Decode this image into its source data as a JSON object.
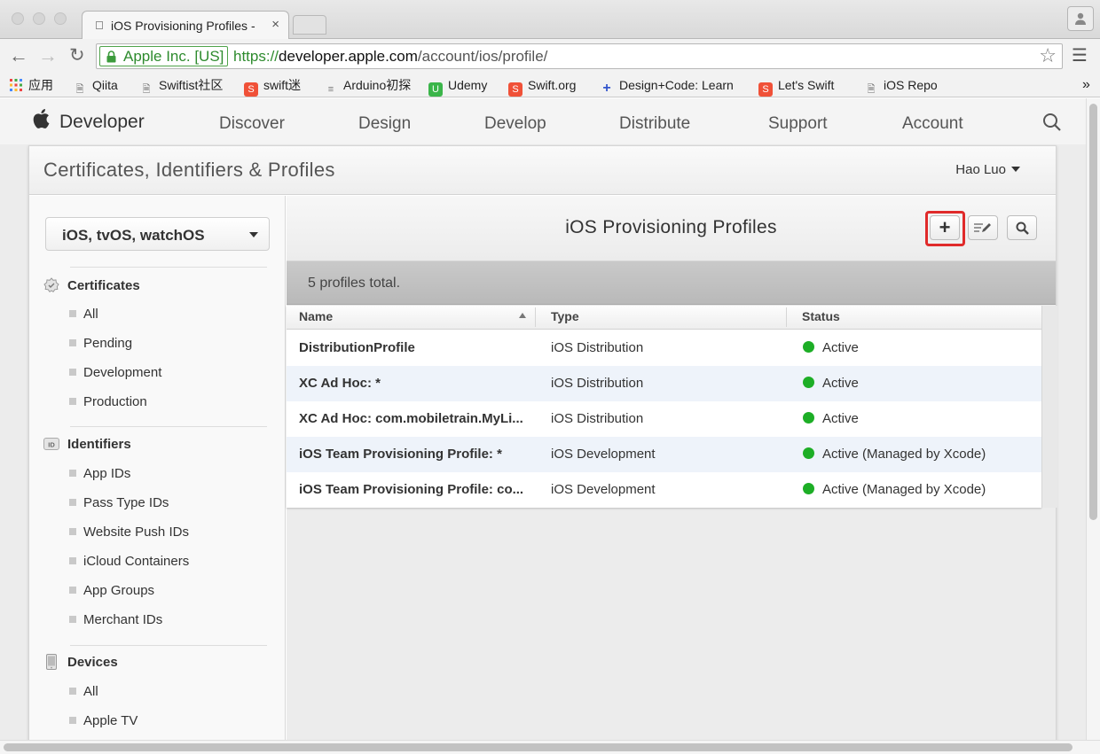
{
  "browser": {
    "tab_title": "iOS Provisioning Profiles -",
    "tab_close": "×",
    "url_ev_badge": "Apple Inc. [US]",
    "url_scheme": "https://",
    "url_host": "developer.apple.com",
    "url_path": "/account/ios/profile/",
    "bookmarks": [
      {
        "label": "应用",
        "icon": "apps-icon"
      },
      {
        "label": "Qiita",
        "icon": "page-icon"
      },
      {
        "label": "Swiftist社区",
        "icon": "page-icon"
      },
      {
        "label": "swift迷",
        "icon": "swift-icon"
      },
      {
        "label": "Arduino初探",
        "icon": "list-icon"
      },
      {
        "label": "Udemy",
        "icon": "udemy-icon"
      },
      {
        "label": "Swift.org",
        "icon": "swift-icon"
      },
      {
        "label": "Design+Code: Learn",
        "icon": "plus-icon"
      },
      {
        "label": "Let's Swift",
        "icon": "swift-icon"
      },
      {
        "label": "iOS Repo",
        "icon": "page-icon"
      }
    ],
    "bookmarks_overflow": "»"
  },
  "site": {
    "brand": "Developer",
    "nav": [
      "Discover",
      "Design",
      "Develop",
      "Distribute",
      "Support",
      "Account"
    ]
  },
  "panel": {
    "title": "Certificates, Identifiers & Profiles",
    "user": "Hao Luo"
  },
  "sidebar": {
    "platform": "iOS, tvOS, watchOS",
    "sections": [
      {
        "title": "Certificates",
        "icon": "certificate-icon",
        "items": [
          "All",
          "Pending",
          "Development",
          "Production"
        ]
      },
      {
        "title": "Identifiers",
        "icon": "id-badge-icon",
        "items": [
          "App IDs",
          "Pass Type IDs",
          "Website Push IDs",
          "iCloud Containers",
          "App Groups",
          "Merchant IDs"
        ]
      },
      {
        "title": "Devices",
        "icon": "device-icon",
        "items": [
          "All",
          "Apple TV"
        ]
      }
    ]
  },
  "content": {
    "title": "iOS Provisioning Profiles",
    "add_label": "+",
    "total": "5 profiles total.",
    "columns": [
      "Name",
      "Type",
      "Status"
    ],
    "rows": [
      {
        "name": "DistributionProfile",
        "type": "iOS Distribution",
        "status": "Active"
      },
      {
        "name": "XC Ad Hoc: *",
        "type": "iOS Distribution",
        "status": "Active"
      },
      {
        "name": "XC Ad Hoc: com.mobiletrain.MyLi...",
        "type": "iOS Distribution",
        "status": "Active"
      },
      {
        "name": "iOS Team Provisioning Profile: *",
        "type": "iOS Development",
        "status": "Active (Managed by Xcode)"
      },
      {
        "name": "iOS Team Provisioning Profile: co...",
        "type": "iOS Development",
        "status": "Active (Managed by Xcode)"
      }
    ],
    "status_color": "#1dae26",
    "highlight_color": "#e02a2a"
  }
}
